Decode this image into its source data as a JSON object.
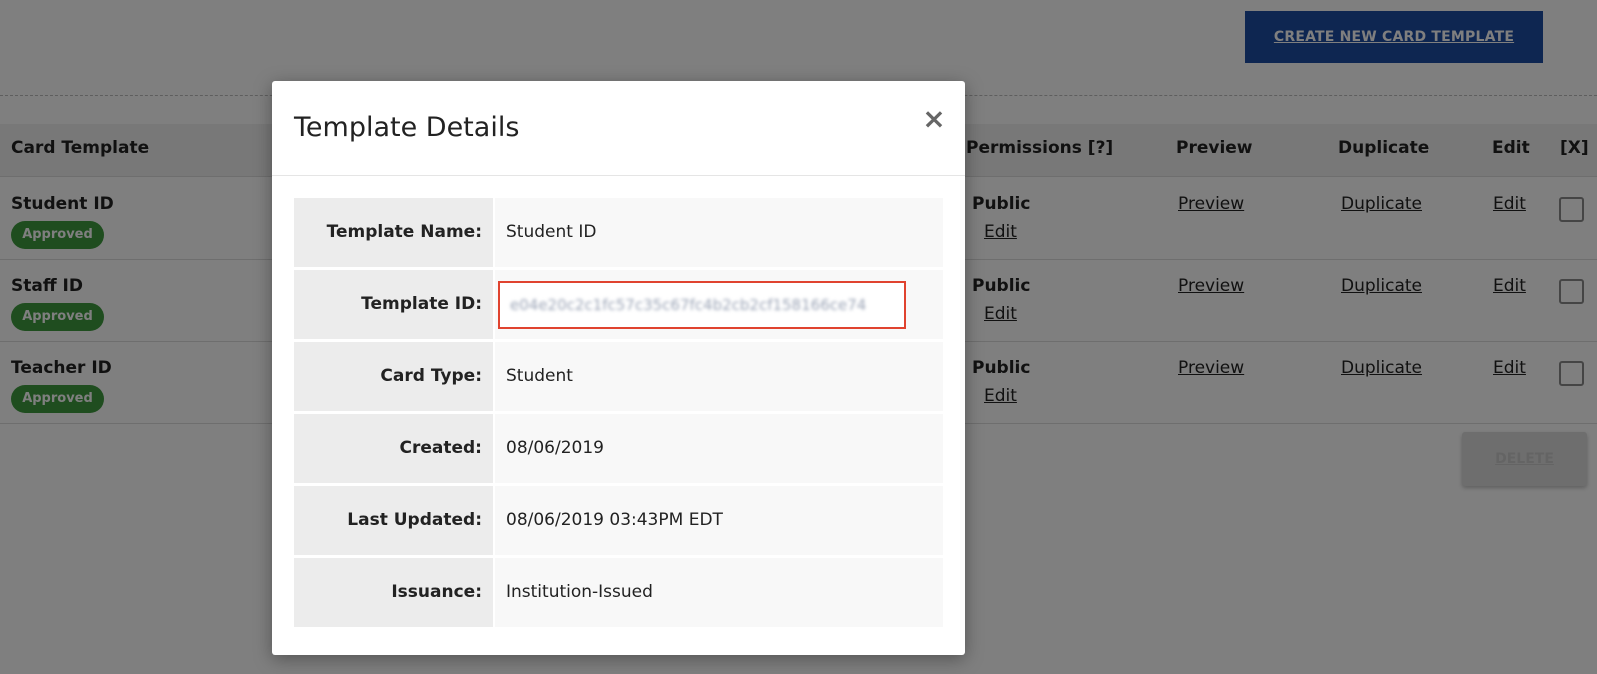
{
  "toolbar": {
    "create_label": "CREATE NEW CARD TEMPLATE",
    "delete_label": "DELETE"
  },
  "table": {
    "headers": {
      "card_template": "Card Template",
      "permissions": "Permissions [?]",
      "preview": "Preview",
      "duplicate": "Duplicate",
      "edit": "Edit",
      "select": "[X]"
    },
    "rows": [
      {
        "name": "Student ID",
        "status": "Approved",
        "permission": "Public",
        "permission_edit": "Edit",
        "preview": "Preview",
        "duplicate": "Duplicate",
        "edit": "Edit"
      },
      {
        "name": "Staff ID",
        "status": "Approved",
        "permission": "Public",
        "permission_edit": "Edit",
        "preview": "Preview",
        "duplicate": "Duplicate",
        "edit": "Edit"
      },
      {
        "name": "Teacher ID",
        "status": "Approved",
        "permission": "Public",
        "permission_edit": "Edit",
        "preview": "Preview",
        "duplicate": "Duplicate",
        "edit": "Edit"
      }
    ]
  },
  "modal": {
    "title": "Template Details",
    "close_glyph": "×",
    "fields": [
      {
        "label": "Template Name:",
        "value": "Student ID"
      },
      {
        "label": "Template ID:",
        "value": "e04e20c2c1fc57c35c67fc4b2cb2cf158166ce74"
      },
      {
        "label": "Card Type:",
        "value": "Student"
      },
      {
        "label": "Created:",
        "value": "08/06/2019"
      },
      {
        "label": "Last Updated:",
        "value": "08/06/2019 03:43PM EDT"
      },
      {
        "label": "Issuance:",
        "value": "Institution-Issued"
      }
    ]
  },
  "colors": {
    "primary_button": "#1d4ca3",
    "approved_badge": "#3e9b3e",
    "highlight_border": "#e0432f"
  }
}
